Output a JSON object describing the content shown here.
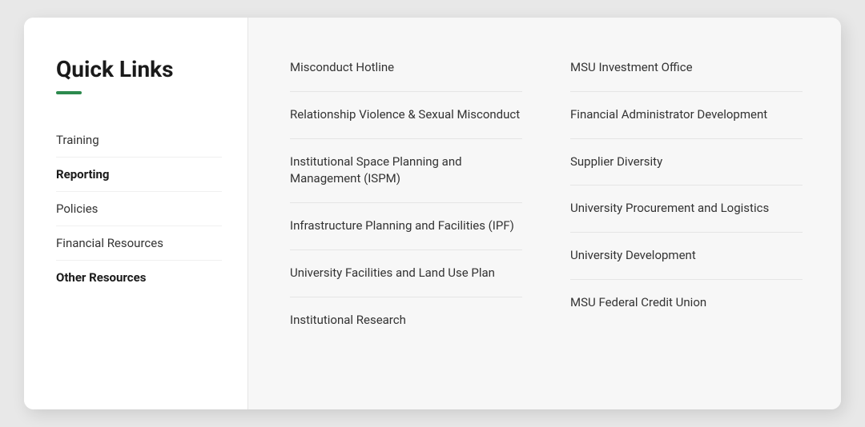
{
  "sidebar": {
    "title": "Quick Links",
    "accent_color": "#2d8a4e",
    "nav_items": [
      {
        "label": "Training",
        "active": false
      },
      {
        "label": "Reporting",
        "active": true
      },
      {
        "label": "Policies",
        "active": false
      },
      {
        "label": "Financial Resources",
        "active": false
      },
      {
        "label": "Other Resources",
        "active": true
      }
    ]
  },
  "columns": [
    {
      "links": [
        {
          "label": "Misconduct Hotline"
        },
        {
          "label": "Relationship Violence & Sexual Misconduct"
        },
        {
          "label": "Institutional Space Planning and Management (ISPM)"
        },
        {
          "label": "Infrastructure Planning and Facilities (IPF)"
        },
        {
          "label": "University Facilities and Land Use Plan"
        },
        {
          "label": "Institutional Research"
        }
      ]
    },
    {
      "links": [
        {
          "label": "MSU Investment Office"
        },
        {
          "label": "Financial Administrator Development"
        },
        {
          "label": "Supplier Diversity"
        },
        {
          "label": "University Procurement and Logistics"
        },
        {
          "label": "University Development"
        },
        {
          "label": "MSU Federal Credit Union"
        }
      ]
    }
  ]
}
